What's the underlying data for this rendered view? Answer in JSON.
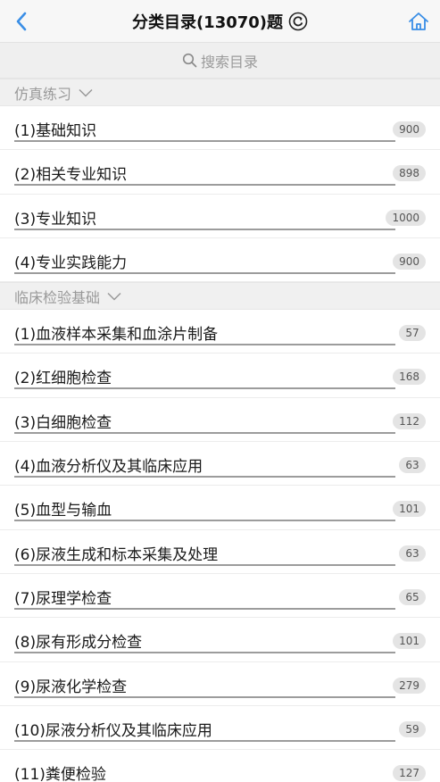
{
  "header": {
    "title": "分类目录(13070)题",
    "back_icon": "chevron-left-icon",
    "refresh_icon": "refresh-icon",
    "home_icon": "home-icon",
    "accent_color": "#3a8ee6"
  },
  "search": {
    "placeholder": "搜索目录",
    "icon": "search-icon"
  },
  "sections": [
    {
      "title": "仿真练习",
      "items": [
        {
          "label": "(1)基础知识",
          "count": "900"
        },
        {
          "label": "(2)相关专业知识",
          "count": "898"
        },
        {
          "label": "(3)专业知识",
          "count": "1000"
        },
        {
          "label": "(4)专业实践能力",
          "count": "900"
        }
      ]
    },
    {
      "title": "临床检验基础",
      "items": [
        {
          "label": "(1)血液样本采集和血涂片制备",
          "count": "57"
        },
        {
          "label": "(2)红细胞检查",
          "count": "168"
        },
        {
          "label": "(3)白细胞检查",
          "count": "112"
        },
        {
          "label": "(4)血液分析仪及其临床应用",
          "count": "63"
        },
        {
          "label": "(5)血型与输血",
          "count": "101"
        },
        {
          "label": "(6)尿液生成和标本采集及处理",
          "count": "63"
        },
        {
          "label": "(7)尿理学检查",
          "count": "65"
        },
        {
          "label": "(8)尿有形成分检查",
          "count": "101"
        },
        {
          "label": "(9)尿液化学检查",
          "count": "279"
        },
        {
          "label": "(10)尿液分析仪及其临床应用",
          "count": "59"
        },
        {
          "label": "(11)粪便检验",
          "count": "127"
        }
      ]
    }
  ]
}
